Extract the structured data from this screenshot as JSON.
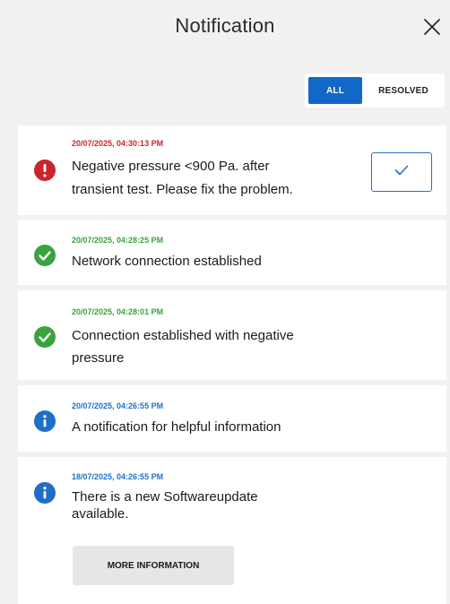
{
  "header": {
    "title": "Notification",
    "close_icon": "close-icon"
  },
  "filter": {
    "tabs": [
      {
        "label": "ALL",
        "active": true
      },
      {
        "label": "RESOLVED",
        "active": false
      }
    ]
  },
  "notifications": [
    {
      "type": "error",
      "timestamp": "20/07/2025, 04:30:13 PM",
      "message_lines": [
        "Negative pressure <900 Pa. after",
        "transient test. Please fix the problem."
      ],
      "icon": "error-icon",
      "action_icon": "checkmark-icon",
      "color": "#c8262b"
    },
    {
      "type": "success",
      "timestamp": "20/07/2025, 04:28:25 PM",
      "message_lines": [
        "Network connection established"
      ],
      "icon": "success-icon",
      "color": "#3aa33f"
    },
    {
      "type": "success",
      "timestamp": "20/07/2025, 04:28:01 PM",
      "message_lines": [
        "Connection established with negative",
        "pressure"
      ],
      "icon": "success-icon",
      "color": "#3aa33f"
    },
    {
      "type": "info",
      "timestamp": "20/07/2025, 04:26:55 PM",
      "message_lines": [
        "A notification for helpful information"
      ],
      "icon": "info-icon",
      "color": "#1f6fc9"
    },
    {
      "type": "info",
      "timestamp": "18/07/2025, 04:26:55 PM",
      "message_lines": [
        "There is a new Softwareupdate",
        "available."
      ],
      "icon": "info-icon",
      "color": "#1f6fc9",
      "button_label": "MORE INFORMATION"
    }
  ],
  "colors": {
    "accent": "#1268c9",
    "background": "#f1f1f2",
    "card": "#ffffff"
  }
}
